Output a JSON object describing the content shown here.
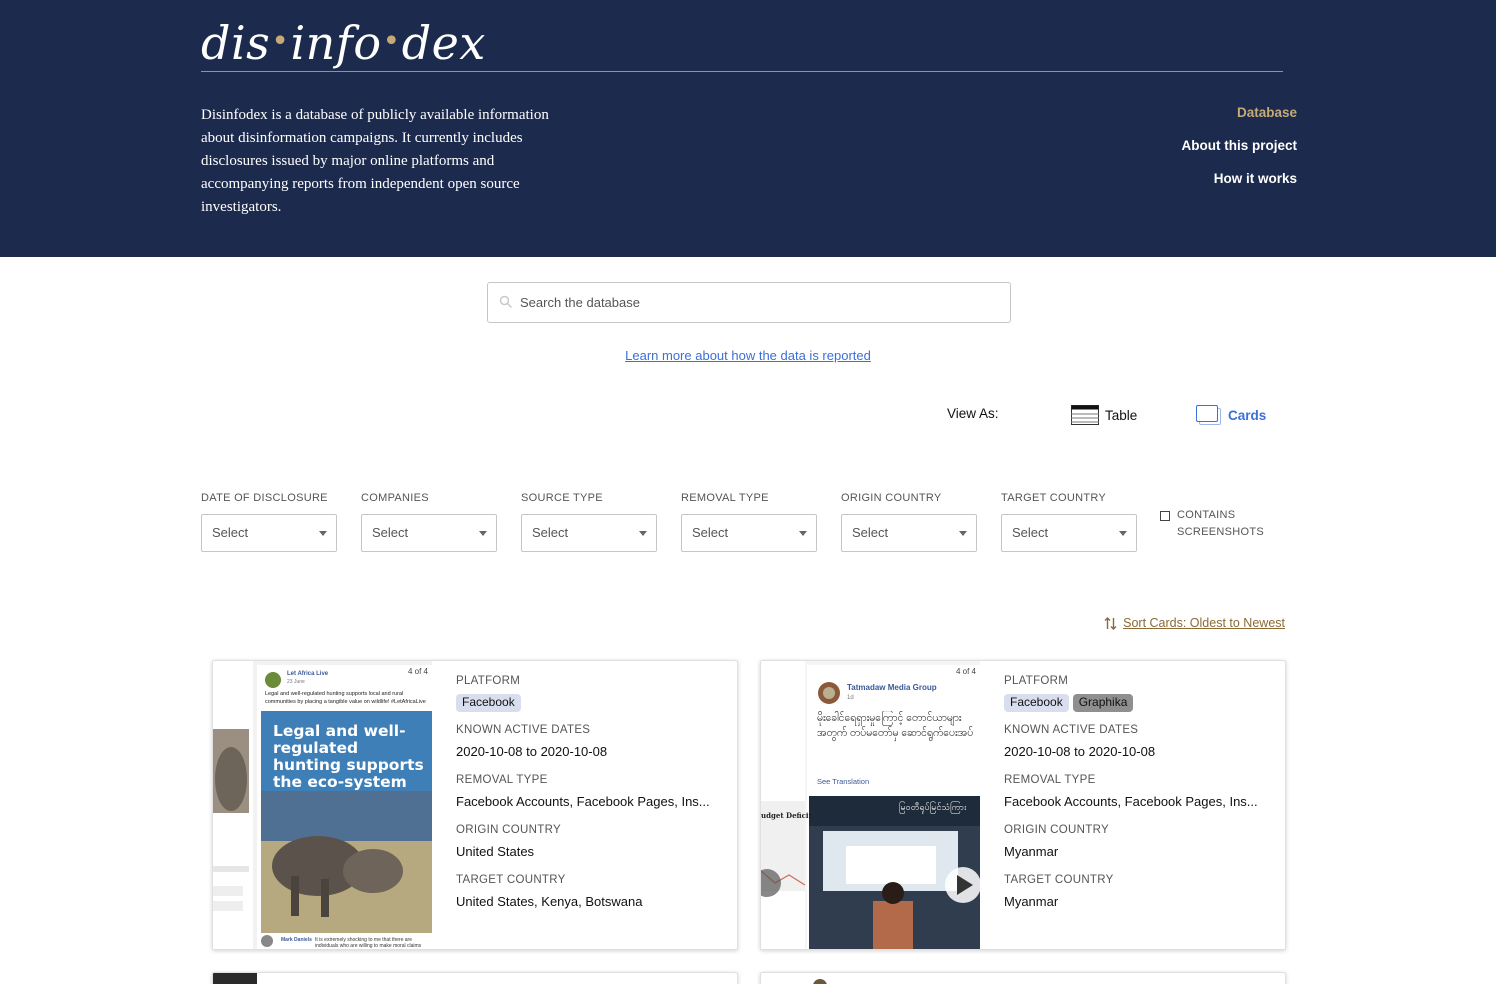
{
  "header": {
    "logo_part1": "dis",
    "logo_part2": "info",
    "logo_part3": "dex",
    "intro": "Disinfodex is a database of publicly available information about disinformation campaigns. It currently includes disclosures issued by major online platforms and accompanying reports from independent open source investigators.",
    "nav": [
      {
        "label": "Database",
        "active": true
      },
      {
        "label": "About this project",
        "active": false
      },
      {
        "label": "How it works",
        "active": false
      }
    ],
    "accent_color": "#c7a976",
    "background_color": "#1c2a4d"
  },
  "search": {
    "placeholder": "Search the database"
  },
  "learn_link": "Learn more about how the data is reported",
  "view_as": {
    "label": "View As:",
    "options": [
      {
        "label": "Table",
        "icon": "table-icon",
        "selected": false
      },
      {
        "label": "Cards",
        "icon": "cards-icon",
        "selected": true
      }
    ]
  },
  "filters": [
    {
      "label": "DATE OF DISCLOSURE",
      "value": "Select"
    },
    {
      "label": "COMPANIES",
      "value": "Select"
    },
    {
      "label": "SOURCE TYPE",
      "value": "Select"
    },
    {
      "label": "REMOVAL TYPE",
      "value": "Select"
    },
    {
      "label": "ORIGIN COUNTRY",
      "value": "Select"
    },
    {
      "label": "TARGET COUNTRY",
      "value": "Select"
    }
  ],
  "screenshots_filter": {
    "line1": "CONTAINS",
    "line2": "SCREENSHOTS",
    "checked": false
  },
  "sort": {
    "label": "Sort Cards: Oldest to Newest"
  },
  "card_labels": {
    "platform": "PLATFORM",
    "dates": "KNOWN ACTIVE DATES",
    "removal": "REMOVAL TYPE",
    "origin": "ORIGIN COUNTRY",
    "target": "TARGET COUNTRY"
  },
  "cards": [
    {
      "platforms": [
        "Facebook"
      ],
      "dates": "2020-10-08 to 2020-10-08",
      "removal": "Facebook Accounts, Facebook Pages, Ins...",
      "origin": "United States",
      "target": "United States, Kenya, Botswana",
      "thumb": {
        "page": "4 of 4",
        "poster": "Let Africa Live",
        "post_date": "23 June",
        "post_text": "Legal and well-regulated hunting supports local and rural communities by placing a tangible value on wildlife! #LetAfricaLive",
        "headline": "Legal and well-regulated hunting supports the eco-system",
        "comment_author": "Mark Daniels",
        "comment": "It is extremely shocking to me that there are individuals who are willing to make moral claims about how"
      }
    },
    {
      "platforms": [
        "Facebook",
        "Graphika"
      ],
      "dates": "2020-10-08 to 2020-10-08",
      "removal": "Facebook Accounts, Facebook Pages, Ins...",
      "origin": "Myanmar",
      "target": "Myanmar",
      "thumb": {
        "page": "4 of 4",
        "poster": "Tatmadaw Media Group",
        "post_date": "1d",
        "post_text": "မိုးခေါင်ရေရှားမှုကြောင့် တောင်ယာများ အတွက် တပ်မတော်မှ ဆောင်ရွက်ပေးအပ်",
        "see_translation": "See Translation",
        "side_label": "udget Deficit",
        "banner": "မြဝတီရုပ်မြင်သံကြား"
      }
    }
  ]
}
